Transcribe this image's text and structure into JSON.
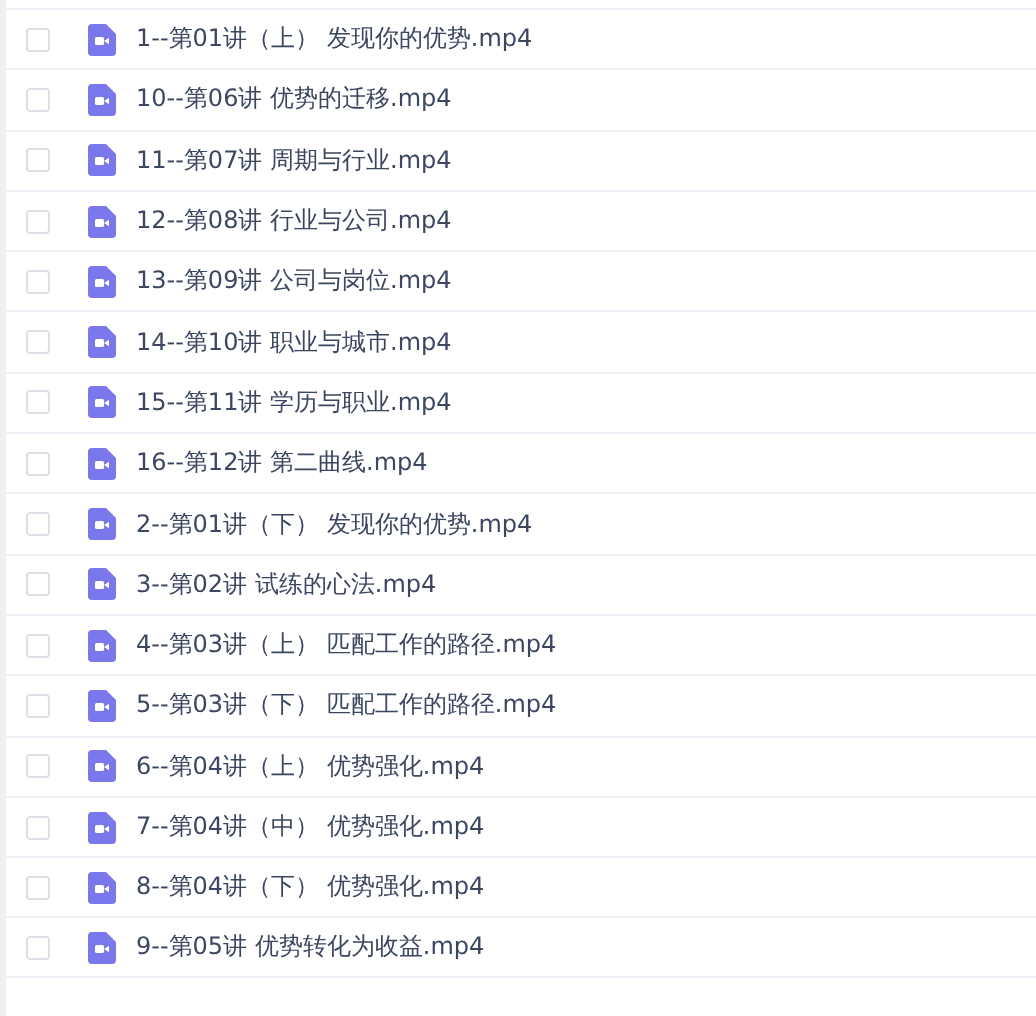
{
  "files": [
    {
      "name": "1--第01讲（上） 发现你的优势.mp4",
      "checked": false
    },
    {
      "name": "10--第06讲 优势的迁移.mp4",
      "checked": false
    },
    {
      "name": "11--第07讲 周期与行业.mp4",
      "checked": false
    },
    {
      "name": "12--第08讲 行业与公司.mp4",
      "checked": false
    },
    {
      "name": "13--第09讲 公司与岗位.mp4",
      "checked": false
    },
    {
      "name": "14--第10讲 职业与城市.mp4",
      "checked": false
    },
    {
      "name": "15--第11讲 学历与职业.mp4",
      "checked": false
    },
    {
      "name": "16--第12讲 第二曲线.mp4",
      "checked": false
    },
    {
      "name": "2--第01讲（下） 发现你的优势.mp4",
      "checked": false
    },
    {
      "name": "3--第02讲 试练的心法.mp4",
      "checked": false
    },
    {
      "name": "4--第03讲（上） 匹配工作的路径.mp4",
      "checked": false
    },
    {
      "name": "5--第03讲（下） 匹配工作的路径.mp4",
      "checked": false
    },
    {
      "name": "6--第04讲（上） 优势强化.mp4",
      "checked": false
    },
    {
      "name": "7--第04讲（中） 优势强化.mp4",
      "checked": false
    },
    {
      "name": "8--第04讲（下） 优势强化.mp4",
      "checked": false
    },
    {
      "name": "9--第05讲 优势转化为收益.mp4",
      "checked": false
    }
  ]
}
